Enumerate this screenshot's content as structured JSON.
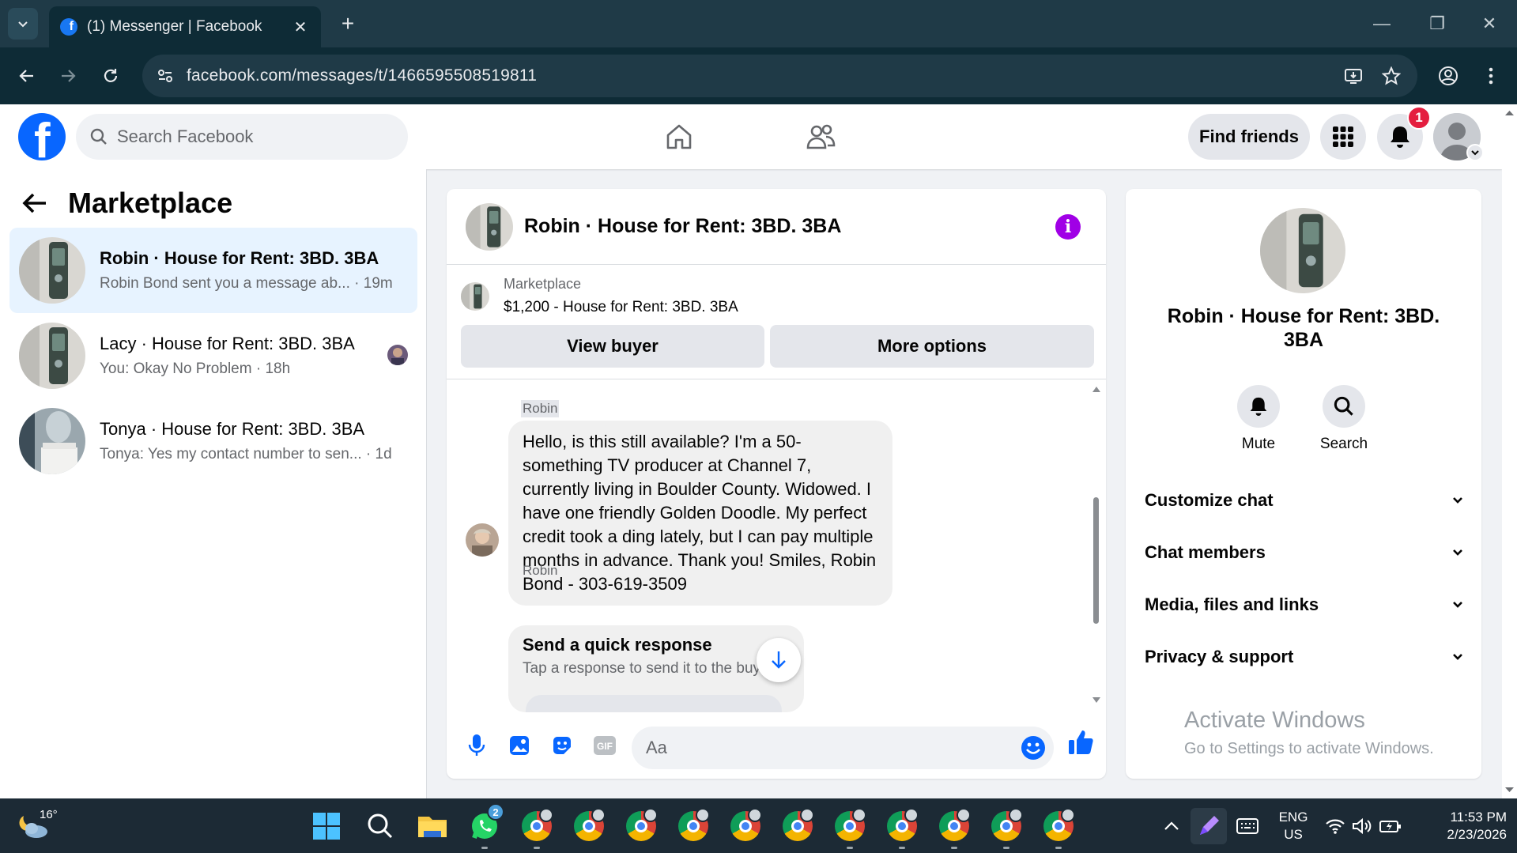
{
  "browser": {
    "tab_title": "(1) Messenger | Facebook",
    "url": "facebook.com/messages/t/1466595508519811"
  },
  "header": {
    "search_placeholder": "Search Facebook",
    "find_friends": "Find friends",
    "notification_count": "1"
  },
  "left": {
    "title": "Marketplace",
    "conversations": [
      {
        "name": "Robin · House for Rent: 3BD. 3BA",
        "preview": "Robin Bond sent you a message ab...",
        "time": "19m"
      },
      {
        "name": "Lacy · House for Rent: 3BD. 3BA",
        "preview": "You: Okay No Problem",
        "time": "18h"
      },
      {
        "name": "Tonya · House for Rent: 3BD. 3BA",
        "preview": "Tonya: Yes my contact number to sen...",
        "time": "1d"
      }
    ]
  },
  "chat": {
    "title": "Robin · House for Rent: 3BD. 3BA",
    "listing_label": "Marketplace",
    "listing_price": "$1,200 - House for Rent: 3BD. 3BA",
    "view_buyer": "View buyer",
    "more_options": "More options",
    "messages": [
      {
        "sender": "Robin",
        "text": "Hello, is this still available? I'm a 50-something TV producer at Channel 7, currently living in Boulder County. Widowed. I have one friendly Golden Doodle. My perfect credit took a ding lately, but I can pay multiple months in advance. Thank you! Smiles, Robin Bond - 303-619-3509"
      },
      {
        "sender": "Robin",
        "quick_title": "Send a quick response",
        "quick_sub": "Tap a response to send it to the buyer."
      }
    ],
    "input_placeholder": "Aa"
  },
  "right": {
    "name": "Robin · House for Rent: 3BD. 3BA",
    "mute": "Mute",
    "search": "Search",
    "sections": [
      "Customize chat",
      "Chat members",
      "Media, files and links",
      "Privacy & support"
    ]
  },
  "watermark": {
    "line1": "Activate Windows",
    "line2": "Go to Settings to activate Windows."
  },
  "taskbar": {
    "temperature": "16°",
    "whatsapp_badge": "2",
    "lang1": "ENG",
    "lang2": "US",
    "time": "11:53 PM",
    "date": "2/23/2026"
  }
}
